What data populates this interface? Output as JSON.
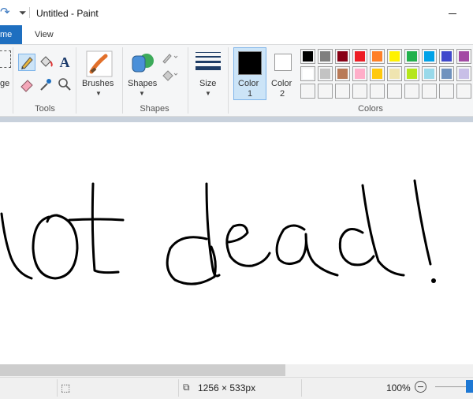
{
  "window": {
    "title": "Untitled - Paint"
  },
  "tabs": {
    "home": "me",
    "view": "View"
  },
  "groups": {
    "image_label": "ge",
    "tools_label": "Tools",
    "brushes_label": "Brushes",
    "shapes_btn_label": "Shapes",
    "shapes_label": "Shapes",
    "size_label": "Size",
    "color1_label": "Color\n1",
    "color1_line1": "Color",
    "color1_line2": "1",
    "color2_line1": "Color",
    "color2_line2": "2",
    "colors_label": "Colors"
  },
  "colors": {
    "color1": "#000000",
    "color2": "#ffffff",
    "palette_row1": [
      "#000000",
      "#7f7f7f",
      "#880015",
      "#ed1c24",
      "#ff7f27",
      "#fff200",
      "#22b14c",
      "#00a2e8",
      "#3f48cc",
      "#a349a4"
    ],
    "palette_row2": [
      "#ffffff",
      "#c3c3c3",
      "#b97a57",
      "#ffaec9",
      "#ffc90e",
      "#efe4b0",
      "#b5e61d",
      "#99d9ea",
      "#7092be",
      "#c8bfe7"
    ],
    "palette_row3": [
      "#f5f5f5",
      "#f5f5f5",
      "#f5f5f5",
      "#f5f5f5",
      "#f5f5f5",
      "#f5f5f5",
      "#f5f5f5",
      "#f5f5f5",
      "#f5f5f5",
      "#f5f5f5"
    ]
  },
  "canvas": {
    "drawn_text": "lot dead!"
  },
  "status": {
    "canvas_size": "1256 × 533px",
    "zoom": "100%"
  }
}
